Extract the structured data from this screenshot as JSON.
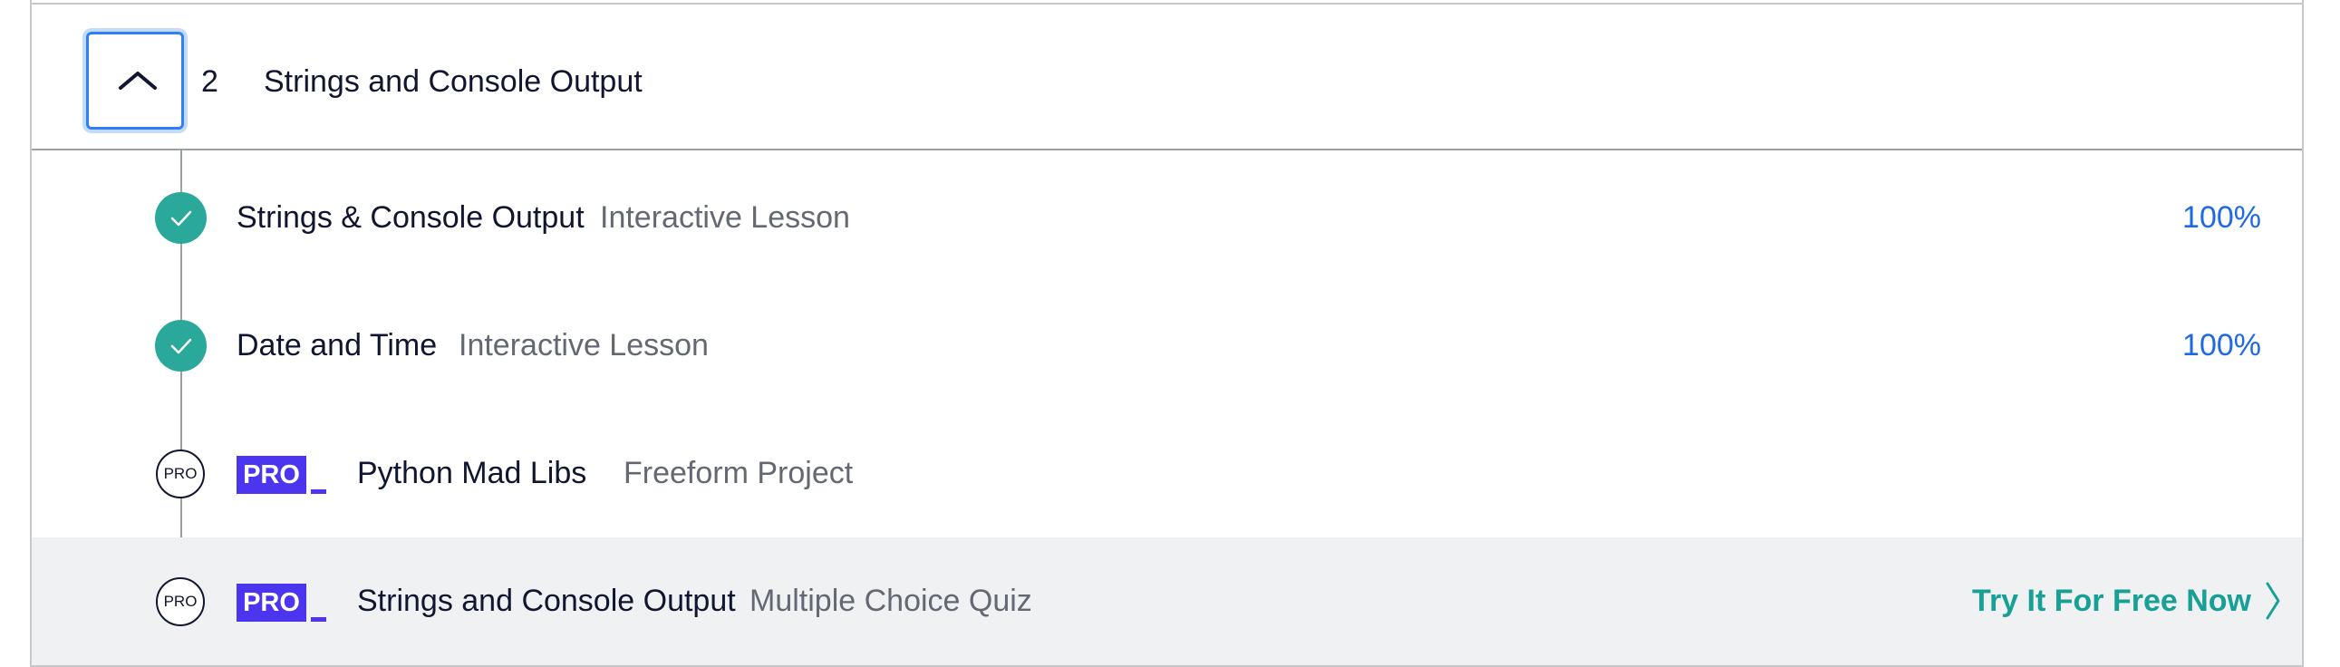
{
  "module": {
    "number": "2",
    "title": "Strings and Console Output",
    "toggle_icon": "chevron-up-icon"
  },
  "items": [
    {
      "title": "Strings & Console Output",
      "type": "Interactive Lesson",
      "progress": "100%",
      "status": "completed"
    },
    {
      "title": "Date and Time",
      "type": "Interactive Lesson",
      "progress": "100%",
      "status": "completed"
    },
    {
      "title": "Python Mad Libs",
      "type": "Freeform Project",
      "status_label": "PRO",
      "badge": "PRO",
      "status": "pro"
    },
    {
      "title": "Strings and Console Output",
      "type": "Multiple Choice Quiz",
      "status_label": "PRO",
      "badge": "PRO",
      "cta": "Try It For Free Now",
      "status": "pro"
    }
  ],
  "colors": {
    "completed": "#2aa89a",
    "pro_badge": "#4b35ef",
    "progress_text": "#1f6ae2",
    "cta_text": "#18a096",
    "focus_ring": "#2f7ff6",
    "highlight_row": "#f0f1f3"
  }
}
